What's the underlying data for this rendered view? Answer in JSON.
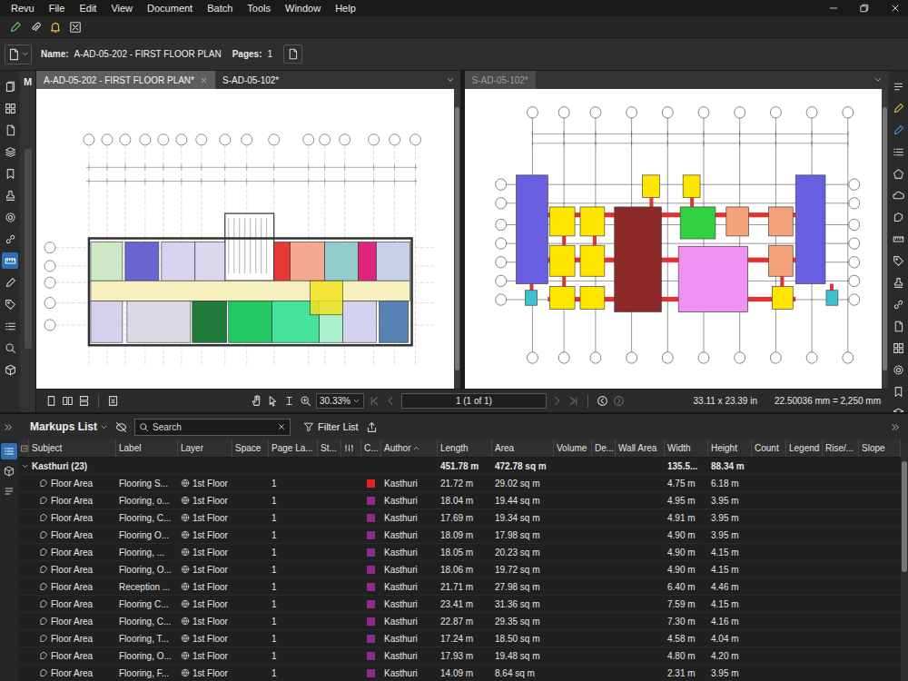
{
  "window": {
    "menu": [
      "Revu",
      "File",
      "Edit",
      "View",
      "Document",
      "Batch",
      "Tools",
      "Window",
      "Help"
    ]
  },
  "document_bar": {
    "name_label": "Name:",
    "name": "A-AD-05-202 - FIRST FLOOR PLAN",
    "pages_label": "Pages:",
    "pages": "1"
  },
  "left_strip": [
    {
      "selected": false
    },
    {
      "selected": false
    },
    {
      "selected": false
    },
    {
      "selected": false
    },
    {
      "selected": false
    },
    {
      "selected": false
    },
    {
      "selected": false
    },
    {
      "selected": false
    },
    {
      "selected": true
    },
    {
      "selected": false
    },
    {
      "selected": false
    },
    {
      "selected": false
    },
    {
      "selected": false
    },
    {
      "selected": false
    }
  ],
  "side_panel": {
    "label": "M"
  },
  "panes": [
    {
      "active": true,
      "tabs": [
        {
          "label": "A-AD-05-202 - FIRST FLOOR PLAN*",
          "selected": true,
          "closable": true
        },
        {
          "label": "S-AD-05-102*",
          "selected": false,
          "closable": false
        }
      ],
      "drawing": {
        "kind": "floor-plan",
        "shapes": [
          {
            "color": "#cde8c4"
          },
          {
            "color": "#6b63d0"
          },
          {
            "color": "#d9d3ef"
          },
          {
            "color": "#ddd6ef"
          },
          {
            "color": "#e53935"
          },
          {
            "color": "#f2a98e"
          },
          {
            "color": "#93cccc"
          },
          {
            "color": "#e0247c"
          },
          {
            "color": "#c9d1e8"
          },
          {
            "color": "#f5f0bd"
          },
          {
            "color": "#d7d0ec"
          },
          {
            "color": "#dcd9e6"
          },
          {
            "color": "#1f7a3c"
          },
          {
            "color": "#22c862"
          },
          {
            "color": "#45e39a"
          },
          {
            "color": "#aaf0cd"
          },
          {
            "color": "#d3d2ef"
          },
          {
            "color": "#5683b3"
          },
          {
            "color": "#f2e320"
          }
        ]
      }
    },
    {
      "active": false,
      "tabs": [
        {
          "label": "S-AD-05-102*",
          "selected": true,
          "closable": false
        }
      ],
      "drawing": {
        "kind": "block-plan",
        "shapes": [
          {
            "color": "#6a5fe0"
          },
          {
            "color": "#ffe600"
          },
          {
            "color": "#ffe600"
          },
          {
            "color": "#ffe600"
          },
          {
            "color": "#ffe600"
          },
          {
            "color": "#ffe600"
          },
          {
            "color": "#ffe600"
          },
          {
            "color": "#ffe600"
          },
          {
            "color": "#ffe600"
          },
          {
            "color": "#ffe600"
          },
          {
            "color": "#40c0d0"
          },
          {
            "color": "#40c0d0"
          },
          {
            "color": "#8c2a2a"
          },
          {
            "color": "#30d040"
          },
          {
            "color": "#f090f0"
          },
          {
            "color": "#f4a37a"
          },
          {
            "color": "#f4a37a"
          },
          {
            "color": "#f4a37a"
          },
          {
            "color": "#6a5fe0"
          }
        ]
      }
    }
  ],
  "navigation": {
    "zoom": "30.33%",
    "page": "1 (1 of 1)",
    "page_size": "33.11 x 23.39 in",
    "scale": "22.50036 mm = 2,250 mm",
    "page_buttons": [
      {
        "disabled": true
      },
      {
        "disabled": true
      },
      {
        "disabled": true
      },
      {
        "disabled": true
      }
    ],
    "history_buttons": [
      {
        "disabled": false
      },
      {
        "disabled": true
      }
    ]
  },
  "markups": {
    "title": "Markups List",
    "search_placeholder": "Search",
    "filter": "Filter List",
    "side_tabs": [
      {
        "selected": true
      },
      {
        "selected": false
      },
      {
        "selected": false
      }
    ],
    "columns": [
      {
        "label": "Subject",
        "kind": "text",
        "sorted": false
      },
      {
        "label": "Label",
        "kind": "text",
        "sorted": false
      },
      {
        "label": "Layer",
        "kind": "text",
        "sorted": false
      },
      {
        "label": "Space",
        "kind": "text",
        "sorted": false
      },
      {
        "label": "Page La...",
        "kind": "text",
        "sorted": false
      },
      {
        "label": "St...",
        "kind": "text",
        "sorted": false
      },
      {
        "label": "",
        "kind": "icon",
        "sorted": false
      },
      {
        "label": "C...",
        "kind": "text",
        "sorted": false
      },
      {
        "label": "Author",
        "kind": "text",
        "sorted": true
      },
      {
        "label": "Length",
        "kind": "text",
        "sorted": false
      },
      {
        "label": "Area",
        "kind": "text",
        "sorted": false
      },
      {
        "label": "Volume",
        "kind": "text",
        "sorted": false
      },
      {
        "label": "De...",
        "kind": "text",
        "sorted": false
      },
      {
        "label": "Wall Area",
        "kind": "text",
        "sorted": false
      },
      {
        "label": "Width",
        "kind": "text",
        "sorted": false
      },
      {
        "label": "Height",
        "kind": "text",
        "sorted": false
      },
      {
        "label": "Count",
        "kind": "text",
        "sorted": false
      },
      {
        "label": "Legend",
        "kind": "text",
        "sorted": false
      },
      {
        "label": "Rise/...",
        "kind": "text",
        "sorted": false
      },
      {
        "label": "Slope",
        "kind": "text",
        "sorted": false
      }
    ],
    "group": {
      "label": "Kasthuri (23)",
      "expanded": true,
      "totals": {
        "length": "451.78 m",
        "area": "472.78 sq m",
        "width": "135.5...",
        "height": "88.34 m"
      }
    },
    "rows": [
      {
        "subject": "Floor Area",
        "label": "Flooring S...",
        "layer": "1st Floor",
        "page": "1",
        "color": "#e02424",
        "author": "Kasthuri",
        "length": "21.72 m",
        "area": "29.02 sq m",
        "width": "4.75 m",
        "height": "6.18 m"
      },
      {
        "subject": "Floor Area",
        "label": "Flooring, o...",
        "layer": "1st Floor",
        "page": "1",
        "color": "#8b2a8f",
        "author": "Kasthuri",
        "length": "18.04 m",
        "area": "19.44 sq m",
        "width": "4.95 m",
        "height": "3.95 m"
      },
      {
        "subject": "Floor Area",
        "label": "Flooring, C...",
        "layer": "1st Floor",
        "page": "1",
        "color": "#8b2a8f",
        "author": "Kasthuri",
        "length": "17.69 m",
        "area": "19.34 sq m",
        "width": "4.91 m",
        "height": "3.95 m"
      },
      {
        "subject": "Floor Area",
        "label": "Flooring O...",
        "layer": "1st Floor",
        "page": "1",
        "color": "#8b2a8f",
        "author": "Kasthuri",
        "length": "18.09 m",
        "area": "17.98 sq m",
        "width": "4.90 m",
        "height": "3.95 m"
      },
      {
        "subject": "Floor Area",
        "label": "Flooring, ...",
        "layer": "1st Floor",
        "page": "1",
        "color": "#8b2a8f",
        "author": "Kasthuri",
        "length": "18.05 m",
        "area": "20.23 sq m",
        "width": "4.90 m",
        "height": "4.15 m"
      },
      {
        "subject": "Floor Area",
        "label": "Flooring, O...",
        "layer": "1st Floor",
        "page": "1",
        "color": "#8b2a8f",
        "author": "Kasthuri",
        "length": "18.06 m",
        "area": "19.72 sq m",
        "width": "4.90 m",
        "height": "4.15 m"
      },
      {
        "subject": "Floor Area",
        "label": "Reception ...",
        "layer": "1st Floor",
        "page": "1",
        "color": "#8b2a8f",
        "author": "Kasthuri",
        "length": "21.71 m",
        "area": "27.98 sq m",
        "width": "6.40 m",
        "height": "4.46 m"
      },
      {
        "subject": "Floor Area",
        "label": "Flooring C...",
        "layer": "1st Floor",
        "page": "1",
        "color": "#8b2a8f",
        "author": "Kasthuri",
        "length": "23.41 m",
        "area": "31.36 sq m",
        "width": "7.59 m",
        "height": "4.15 m"
      },
      {
        "subject": "Floor Area",
        "label": "Flooring, C...",
        "layer": "1st Floor",
        "page": "1",
        "color": "#8b2a8f",
        "author": "Kasthuri",
        "length": "22.87 m",
        "area": "29.35 sq m",
        "width": "7.30 m",
        "height": "4.16 m"
      },
      {
        "subject": "Floor Area",
        "label": "Flooring, T...",
        "layer": "1st Floor",
        "page": "1",
        "color": "#8b2a8f",
        "author": "Kasthuri",
        "length": "17.24 m",
        "area": "18.50 sq m",
        "width": "4.58 m",
        "height": "4.04 m"
      },
      {
        "subject": "Floor Area",
        "label": "Flooring, O...",
        "layer": "1st Floor",
        "page": "1",
        "color": "#8b2a8f",
        "author": "Kasthuri",
        "length": "17.93 m",
        "area": "19.48 sq m",
        "width": "4.80 m",
        "height": "4.20 m"
      },
      {
        "subject": "Floor Area",
        "label": "Flooring, F...",
        "layer": "1st Floor",
        "page": "1",
        "color": "#8b2a8f",
        "author": "Kasthuri",
        "length": "14.09 m",
        "area": "8.64 sq m",
        "width": "2.31 m",
        "height": "3.95 m"
      }
    ]
  }
}
